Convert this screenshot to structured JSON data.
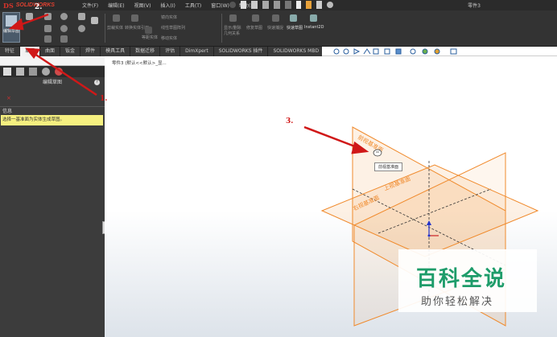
{
  "app": {
    "logo_ds": "DS",
    "logo_name": "SOLIDWORKS",
    "doc_title": "零件3"
  },
  "menu": [
    "文件(F)",
    "编辑(E)",
    "视图(V)",
    "插入(I)",
    "工具(T)",
    "窗口(W)",
    "帮助(H)"
  ],
  "ribbon": {
    "edit_sketch": "编辑草图",
    "labels": [
      "剪裁实体",
      "转换实体引用",
      "等距实体",
      "镜向实体",
      "线性草图阵列",
      "移动实体",
      "显示/删除几何关系",
      "修复草图",
      "快速捕捉",
      "快速草图",
      "Instant2D"
    ]
  },
  "tabs": [
    "特征",
    "草图",
    "曲面",
    "钣金",
    "焊件",
    "模具工具",
    "数据迁移",
    "评估",
    "DimXpert",
    "SOLIDWORKS 插件",
    "SOLIDWORKS MBD"
  ],
  "active_tab": "草图",
  "panel": {
    "title": "编辑草图",
    "help": "?",
    "close": "×",
    "info_header": "信息",
    "info_text": "选择一基准面为实体生成草图。"
  },
  "breadcrumb": "零件3 (默认<<默认>_显...",
  "tooltip": "前视基准面",
  "plane_labels": [
    "前视基准面",
    "上视基准面",
    "右视基准面"
  ],
  "annotations": [
    "1.",
    "2.",
    "3."
  ],
  "watermark": {
    "title": "百科全说",
    "subtitle": "助你轻松解决"
  },
  "colors": {
    "plane_orange": "#f08a2c",
    "arrow_red": "#d01818",
    "watermark_green": "#1e9c6a"
  }
}
